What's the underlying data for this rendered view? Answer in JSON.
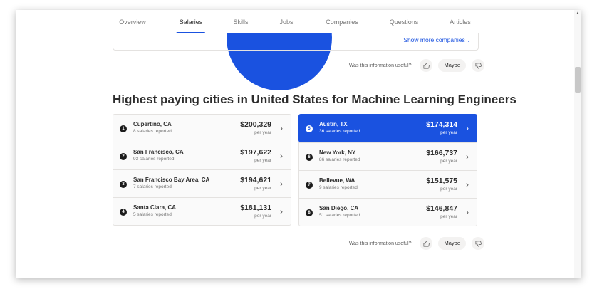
{
  "nav": {
    "tabs": [
      {
        "label": "Overview"
      },
      {
        "label": "Salaries",
        "active": true
      },
      {
        "label": "Skills"
      },
      {
        "label": "Jobs"
      },
      {
        "label": "Companies"
      },
      {
        "label": "Questions"
      },
      {
        "label": "Articles"
      }
    ]
  },
  "companies": {
    "show_more_label": "Show more companies"
  },
  "feedback": {
    "question": "Was this information useful?",
    "thumbs_up_icon": "thumbs-up-icon",
    "maybe_label": "Maybe",
    "thumbs_down_icon": "thumbs-down-icon"
  },
  "cities": {
    "heading": "Highest paying cities in United States for Machine Learning Engineers",
    "left": [
      {
        "rank": "1",
        "name": "Cupertino, CA",
        "count": "8 salaries reported",
        "salary": "$200,329",
        "period": "per year"
      },
      {
        "rank": "2",
        "name": "San Francisco, CA",
        "count": "93 salaries reported",
        "salary": "$197,622",
        "period": "per year"
      },
      {
        "rank": "3",
        "name": "San Francisco Bay Area, CA",
        "count": "7 salaries reported",
        "salary": "$194,621",
        "period": "per year"
      },
      {
        "rank": "4",
        "name": "Santa Clara, CA",
        "count": "5 salaries reported",
        "salary": "$181,131",
        "period": "per year"
      }
    ],
    "right": [
      {
        "rank": "5",
        "name": "Austin, TX",
        "count": "36 salaries reported",
        "salary": "$174,314",
        "period": "per year",
        "active": true
      },
      {
        "rank": "6",
        "name": "New York, NY",
        "count": "86 salaries reported",
        "salary": "$166,737",
        "period": "per year"
      },
      {
        "rank": "7",
        "name": "Bellevue, WA",
        "count": "9 salaries reported",
        "salary": "$151,575",
        "period": "per year"
      },
      {
        "rank": "8",
        "name": "San Diego, CA",
        "count": "51 salaries reported",
        "salary": "$146,847",
        "period": "per year"
      }
    ]
  },
  "colors": {
    "accent": "#1a52e0",
    "text": "#2d2d2d",
    "muted": "#767676"
  }
}
